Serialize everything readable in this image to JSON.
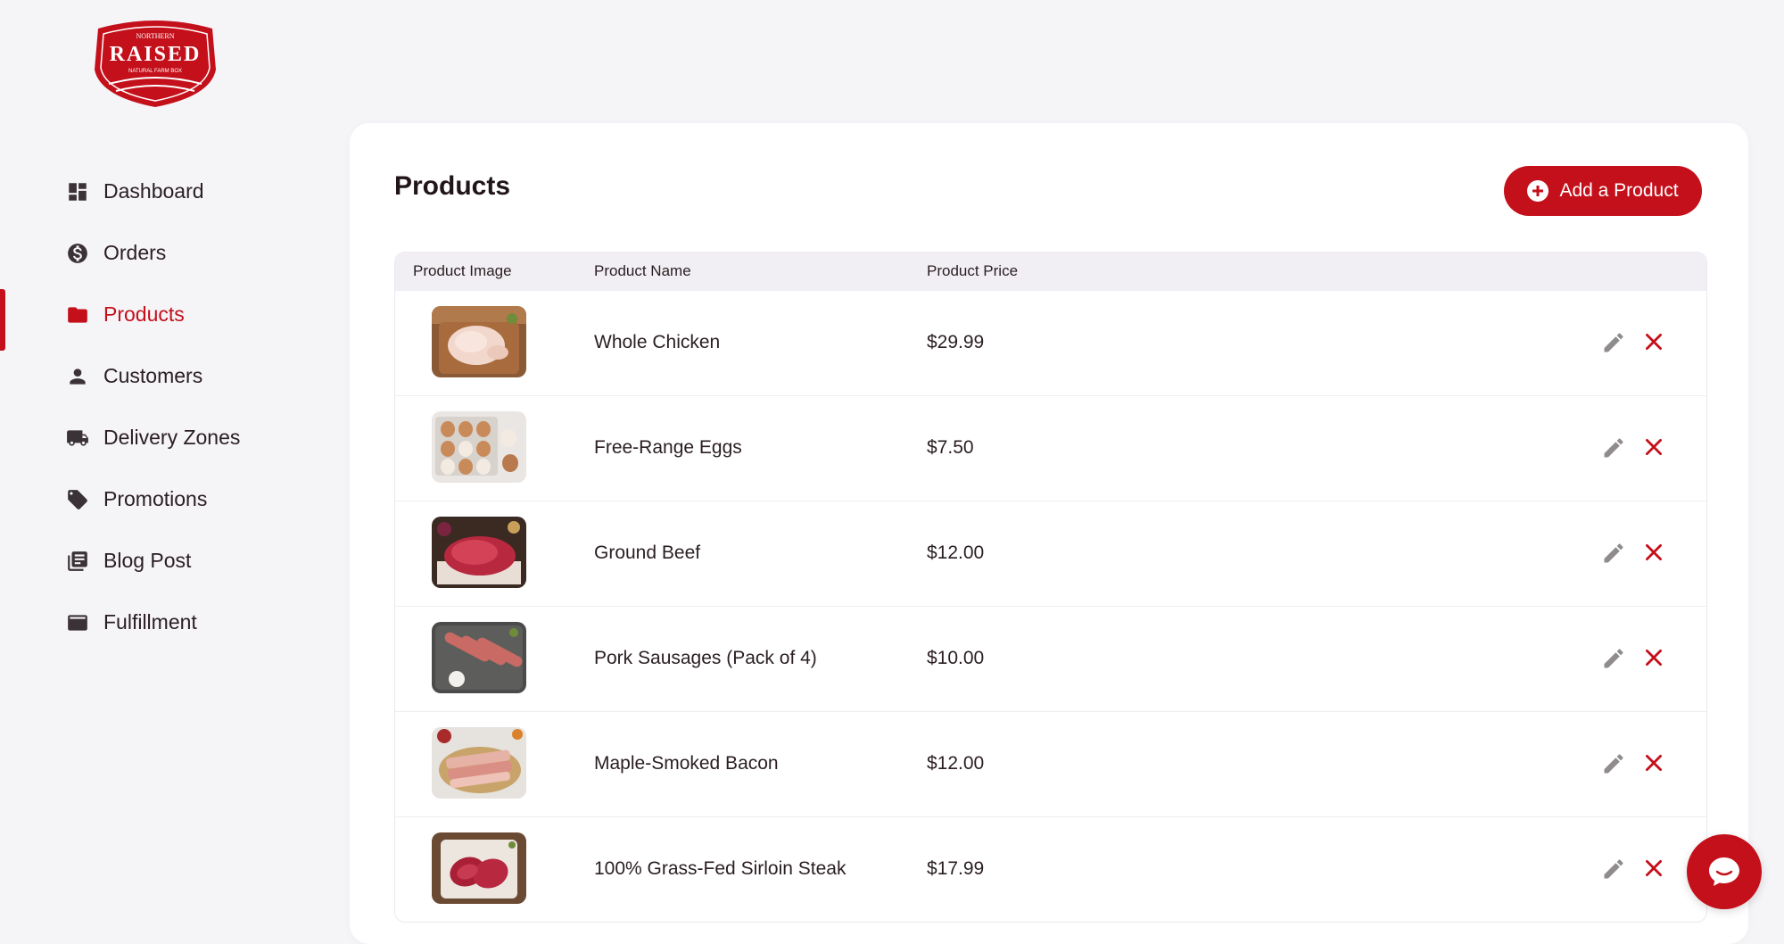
{
  "brand": {
    "logo_top": "NORTHERN",
    "logo_main": "RAISED",
    "logo_sub": "NATURAL FARM BOX",
    "accent_color": "#c4101b"
  },
  "sidebar": {
    "items": [
      {
        "label": "Dashboard",
        "icon": "dashboard-icon",
        "active": false
      },
      {
        "label": "Orders",
        "icon": "dollar-circle-icon",
        "active": false
      },
      {
        "label": "Products",
        "icon": "folder-icon",
        "active": true
      },
      {
        "label": "Customers",
        "icon": "person-icon",
        "active": false
      },
      {
        "label": "Delivery Zones",
        "icon": "truck-icon",
        "active": false
      },
      {
        "label": "Promotions",
        "icon": "tag-icon",
        "active": false
      },
      {
        "label": "Blog Post",
        "icon": "library-books-icon",
        "active": false
      },
      {
        "label": "Fulfillment",
        "icon": "card-icon",
        "active": false
      }
    ]
  },
  "main": {
    "title": "Products",
    "add_button_label": "Add a Product",
    "table": {
      "columns": [
        "Product Image",
        "Product Name",
        "Product Price"
      ],
      "rows": [
        {
          "name": "Whole Chicken",
          "price": "$29.99",
          "image": "chicken-photo"
        },
        {
          "name": "Free-Range Eggs",
          "price": "$7.50",
          "image": "eggs-photo"
        },
        {
          "name": "Ground Beef",
          "price": "$12.00",
          "image": "ground-beef-photo"
        },
        {
          "name": "Pork Sausages (Pack of 4)",
          "price": "$10.00",
          "image": "sausages-photo"
        },
        {
          "name": "Maple-Smoked Bacon",
          "price": "$12.00",
          "image": "bacon-photo"
        },
        {
          "name": "100% Grass-Fed Sirloin Steak",
          "price": "$17.99",
          "image": "steak-photo"
        }
      ]
    }
  },
  "chat": {
    "icon": "chat-bubble-icon"
  }
}
